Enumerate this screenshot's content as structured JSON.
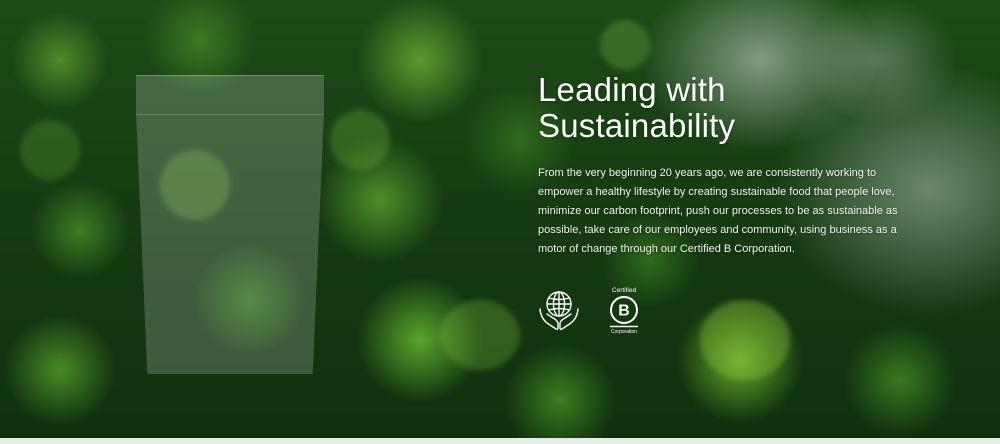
{
  "hero": {
    "title_line1": "Leading with",
    "title_line2": "Sustainability",
    "body": "From the very beginning 20 years ago, we are consistently working to empower a healthy lifestyle by creating sustainable food that people love, minimize our carbon footprint, push our processes to be as sustainable as possible, take care of our employees and community,  using business as a motor of change through our Certified B Corporation.",
    "badges": {
      "globe_icon": "globe-in-hands-icon",
      "bcorp_top": "Certified",
      "bcorp_letter": "B",
      "bcorp_bottom": "Corporation"
    }
  },
  "colors": {
    "text": "#ffffff",
    "forest_dark": "#10300e",
    "forest_mid": "#3c7a22",
    "forest_light": "#6aaa2a",
    "mist": "#d2e1d7"
  }
}
